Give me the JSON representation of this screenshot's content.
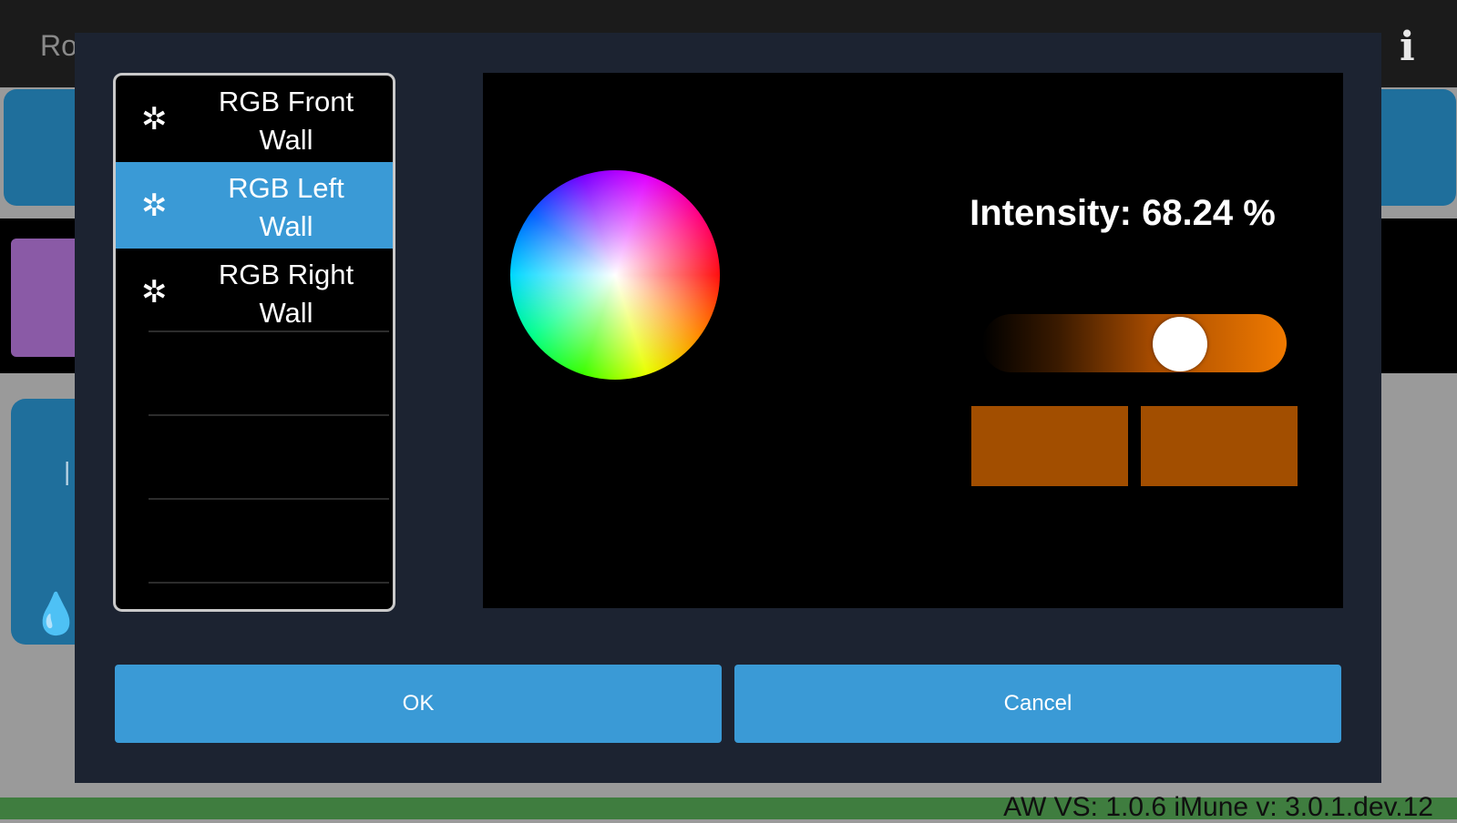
{
  "app": {
    "title": "Ro",
    "info_icon": "info-icon"
  },
  "background": {
    "footer_version": "AW VS: 1.0.6  iMune v: 3.0.1.dev.12",
    "drop_icon": "water-drop-icon"
  },
  "dialog": {
    "list": [
      {
        "label": "RGB Front Wall",
        "icon": "gear-icon",
        "selected": false
      },
      {
        "label": "RGB Left Wall",
        "icon": "gear-icon",
        "selected": true
      },
      {
        "label": "RGB Right Wall",
        "icon": "gear-icon",
        "selected": false
      }
    ],
    "intensity_label": "Intensity: 68.24 %",
    "intensity_value": 68.24,
    "selected_color": "#f07a00",
    "swatch_color": "#a24e00",
    "ok_label": "OK",
    "cancel_label": "Cancel"
  }
}
